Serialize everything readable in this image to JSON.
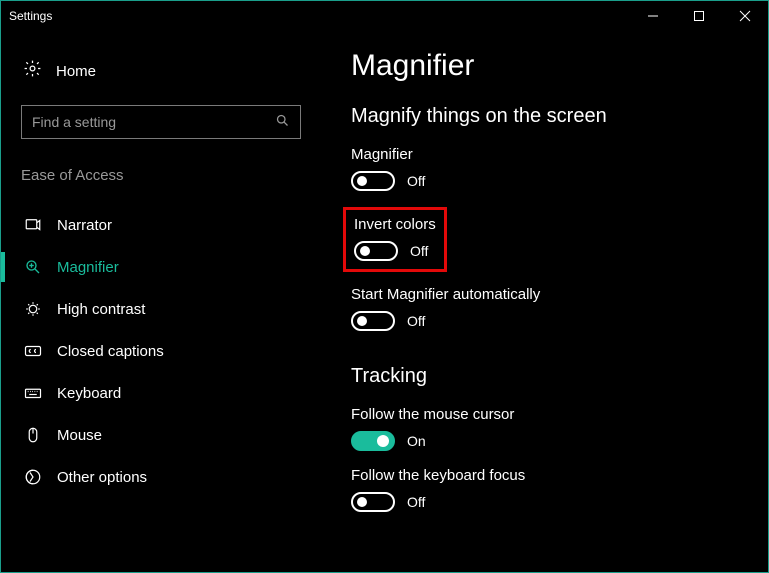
{
  "window": {
    "title": "Settings"
  },
  "sidebar": {
    "home_label": "Home",
    "search_placeholder": "Find a setting",
    "category": "Ease of Access",
    "items": [
      {
        "label": "Narrator"
      },
      {
        "label": "Magnifier"
      },
      {
        "label": "High contrast"
      },
      {
        "label": "Closed captions"
      },
      {
        "label": "Keyboard"
      },
      {
        "label": "Mouse"
      },
      {
        "label": "Other options"
      }
    ]
  },
  "main": {
    "title": "Magnifier",
    "section1": {
      "heading": "Magnify things on the screen",
      "settings": {
        "magnifier": {
          "label": "Magnifier",
          "state": "Off"
        },
        "invert_colors": {
          "label": "Invert colors",
          "state": "Off"
        },
        "auto_start": {
          "label": "Start Magnifier automatically",
          "state": "Off"
        }
      }
    },
    "section2": {
      "heading": "Tracking",
      "settings": {
        "follow_cursor": {
          "label": "Follow the mouse cursor",
          "state": "On"
        },
        "follow_keyboard": {
          "label": "Follow the keyboard focus",
          "state": "Off"
        }
      }
    }
  },
  "colors": {
    "accent": "#1abc9c",
    "highlight": "#e30909"
  }
}
